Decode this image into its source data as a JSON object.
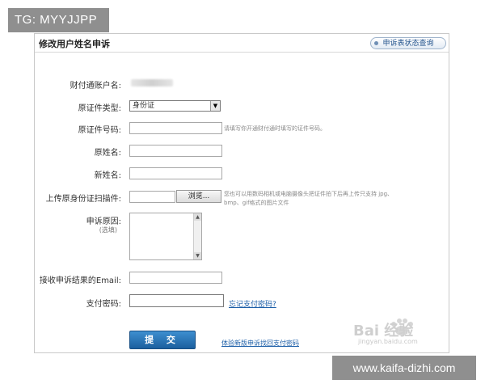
{
  "overlay": {
    "tg_label": "TG: MYYJJPP",
    "site_label": "www.kaifa-dizhi.com"
  },
  "form": {
    "title": "修改用户姓名申诉",
    "status_button": "申诉表状态查询",
    "account_label": "财付通账户名:",
    "id_type_label": "原证件类型:",
    "id_type_selected": "身份证",
    "id_number_label": "原证件号码:",
    "id_number_hint": "请填写你开通财付通时填写的证件号码。",
    "old_name_label": "原姓名:",
    "new_name_label": "新姓名:",
    "upload_label": "上传原身份证扫描件:",
    "browse_button": "浏览...",
    "upload_hint_1": "您也可以用数码相机或电脑摄像头把证件拍下后再上传只支持 jpg、",
    "upload_hint_2": "bmp、gif格式的图片文件",
    "reason_label": "申诉原因:",
    "reason_optional": "(选填)",
    "email_label": "接收申诉结果的Email:",
    "password_label": "支付密码:",
    "forgot_password_link": "忘记支付密码?",
    "submit_button": "提 交",
    "new_appeal_link": "体验新版申诉找回支付密码"
  },
  "watermark": {
    "brand": "Bai 经验",
    "url": "jingyan.baidu.com"
  },
  "colors": {
    "accent": "#1b5f9e",
    "link": "#1d5fa8",
    "overlay_bg": "#8f8f8f"
  }
}
